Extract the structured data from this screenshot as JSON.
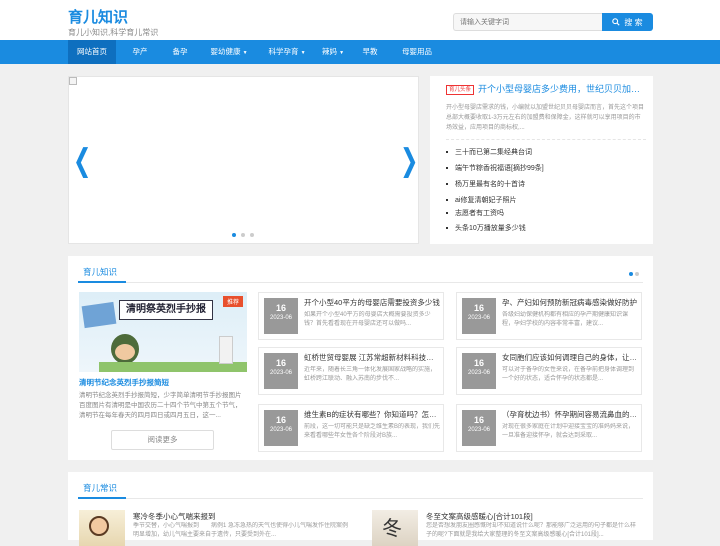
{
  "header": {
    "logo": "育儿知识",
    "slogan": "育儿小知识,科学育儿常识",
    "search_placeholder": "请输入关键字词",
    "search_button": "搜 索"
  },
  "nav": [
    {
      "label": "网站首页",
      "active": true
    },
    {
      "label": "孕产"
    },
    {
      "label": "备孕"
    },
    {
      "label": "婴幼健康",
      "dropdown": true
    },
    {
      "label": "科学孕育",
      "dropdown": true
    },
    {
      "label": "辣妈",
      "dropdown": true
    },
    {
      "label": "早教"
    },
    {
      "label": "母婴用品"
    }
  ],
  "headline": {
    "badge": "育儿头条",
    "title": "开个小型母婴店多少费用，世纪贝贝加盟费多少",
    "desc": "开小型母婴店需求的钱，小编就以加盟世纪贝贝母婴店而言，首先这个项目总部大概要收取1-3万元左右的加盟费和保障金，这样就可以享用项目的市场效益，应用项目的商标权,..."
  },
  "hot_list": [
    "三十而已第二集经典台词",
    "端午节粽香祝福语[摘抄99条]",
    "杨万里最有名的十首诗",
    "ai修复清朝妃子照片",
    "志愿者有工资吗",
    "头条10万播放量多少钱"
  ],
  "section1": {
    "title": "育儿知识",
    "featured": {
      "image_caption": "清明祭英烈手抄报",
      "badge": "推荐",
      "title": "清明节纪念英烈手抄报简短",
      "desc": "清明节纪念英烈手抄报简短，少字简单清明节手抄报图片百度图片有清明是中国农历二十四个节气中第五个节气，清明节在每年春天的四月四日或四月五日，这一...",
      "more": "阅读更多"
    },
    "articles": [
      {
        "day": "16",
        "ym": "2023-06",
        "title": "开个小型40平方的母婴店需要投资多少钱",
        "desc": "如果开个小型40平方的母婴店大概需要投资多少钱？首先看看现在开母婴店还可以做吗..."
      },
      {
        "day": "16",
        "ym": "2023-06",
        "title": "孕、产妇如何预防新冠病毒感染做好防护",
        "desc": "各级妇幼保健机构都有相应的孕产期健康知识课程，孕妇学校的内容非常丰富，建议..."
      },
      {
        "day": "16",
        "ym": "2023-06",
        "title": "虹桥世贸母婴展 江苏常超新材料科技有限公司",
        "desc": "近年来，随着长三角一体化发展国家战略的实施，虹桥跨江联动、融入苏南的步伐不..."
      },
      {
        "day": "16",
        "ym": "2023-06",
        "title": "女同胞们应该如何调理自己的身体，让自己孕育",
        "desc": "可以对于备孕的女性来说，在备孕前把身体调理到一个好的状态，适合怀孕的状态都是..."
      },
      {
        "day": "16",
        "ym": "2023-06",
        "title": "维生素B的症状有哪些？你知道吗？怎么补充",
        "desc": "前段，这一切可能只是缺乏维生素B的表现，我们先来看看哪些年女性各个阶段对B族..."
      },
      {
        "day": "16",
        "ym": "2023-06",
        "title": "（孕育枕边书）怀孕期间容易流鼻血的原因",
        "desc": "对现在很多家庭在计划中迎接宝宝的准妈妈来说，一旦准备迎接怀孕，就会达到采取..."
      }
    ]
  },
  "section2": {
    "title": "育儿常识",
    "items": [
      {
        "title": "寒冷冬季小心气喘来报到",
        "desc": "季节交替，小心气喘报到　　病例1 急冻急热的天气也使得小儿气喘发作住院案例明显增加，幼儿气喘主要来自于遗传，只要受到外在..."
      },
      {
        "title": "冬至文案高级感暖心[合计101段]",
        "desc": "您是否想发朋友圈感慨时却不知道说什么呢？那能够广泛运用的句子都是什么样子的呢?下面就是我给大家整理的冬至文案高级感暖心[合计101段]..."
      }
    ]
  }
}
